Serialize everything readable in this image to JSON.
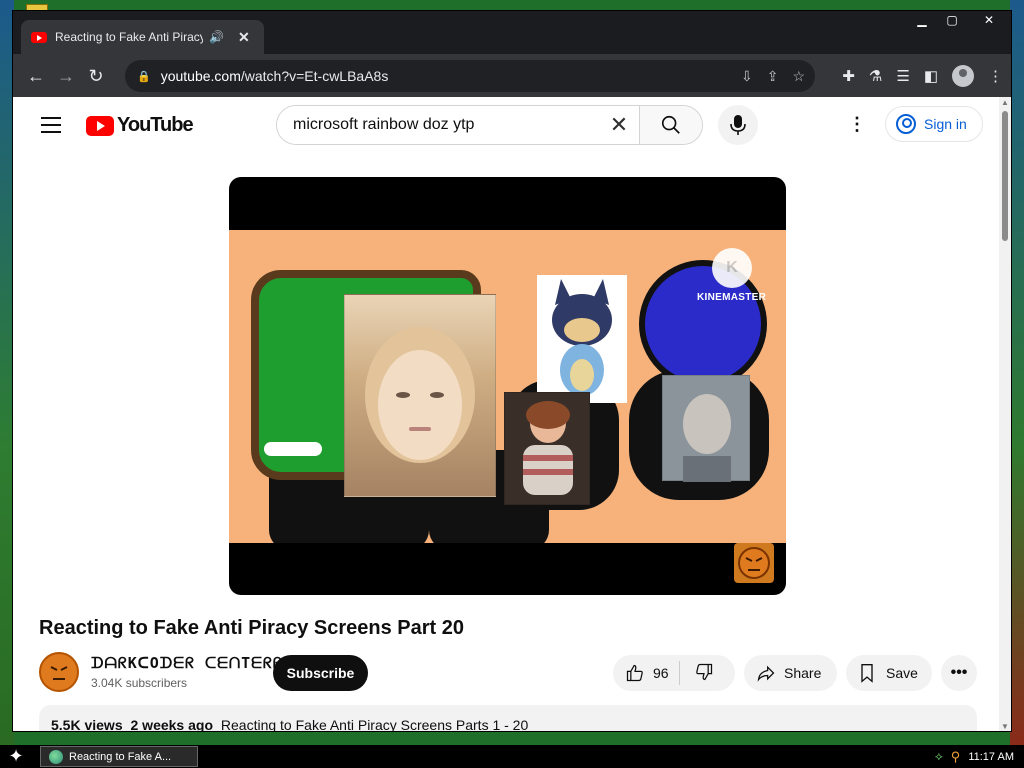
{
  "browser": {
    "tab_title": "Reacting to Fake Anti Piracy Sc",
    "url_host": "youtube.com",
    "url_path": "/watch?v=Et-cwLBaA8s"
  },
  "youtube": {
    "logo_text": "YouTube",
    "search_query": "microsoft rainbow doz ytp",
    "signin_label": "Sign in",
    "video_title": "Reacting to Fake Anti Piracy Screens Part 20",
    "watermark_text": "KINEMASTER",
    "channel_name": "ᗪᗩᖇKᑕOᗪᗴᖇ ᑕᗴᑎTᗴᖇᑭᗴᑕ",
    "subscribers": "3.04K subscribers",
    "subscribe_label": "Subscribe",
    "like_count": "96",
    "share_label": "Share",
    "save_label": "Save",
    "views": "5.5K views",
    "age": "2 weeks ago",
    "description": "Reacting to Fake Anti Piracy Screens Parts 1 - 20"
  },
  "taskbar": {
    "task_label": "Reacting to Fake A...",
    "clock": "11:17 AM"
  },
  "colors": {
    "youtube_red": "#ff0000",
    "link_blue": "#065fd4",
    "chrome_dark": "#35363a"
  }
}
